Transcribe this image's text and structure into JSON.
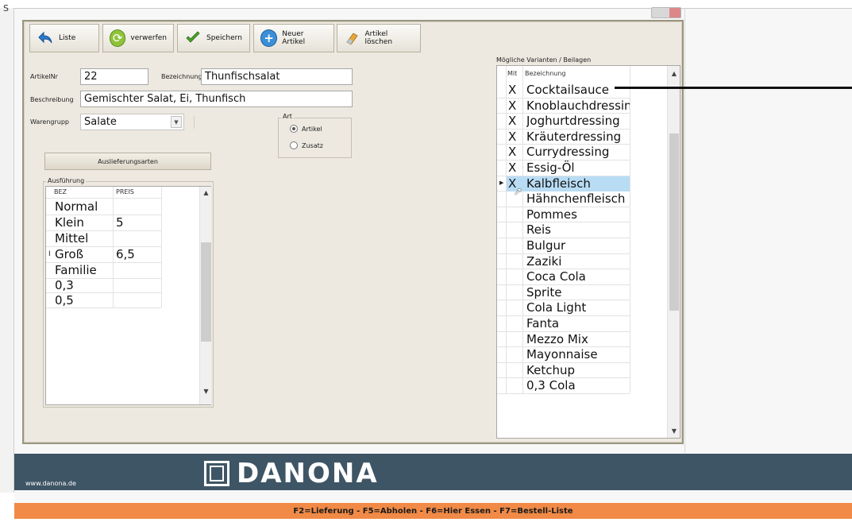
{
  "window": {
    "title_partial": "S"
  },
  "toolbar": {
    "buttons": [
      {
        "label": "Liste",
        "icon": "back-arrow-icon"
      },
      {
        "label": "verwerfen",
        "icon": "refresh-icon"
      },
      {
        "label": "Speichern",
        "icon": "checkmark-icon"
      },
      {
        "label": "Neuer Artikel",
        "icon": "plus-icon"
      },
      {
        "label": "Artikel löschen",
        "icon": "eraser-icon"
      }
    ]
  },
  "form": {
    "artikelnr_label": "ArtikelNr",
    "artikelnr_value": "22",
    "bezeichnung_label": "Bezeichnung",
    "bezeichnung_value": "Thunfischsalat",
    "beschreibung_label": "Beschreibung",
    "beschreibung_value": "Gemischter Salat, Ei, Thunfisch",
    "warengruppe_label": "Warengrupp",
    "warengruppe_value": "Salate",
    "art_title": "Art",
    "art_options": [
      "Artikel",
      "Zusatz"
    ],
    "art_selected": "Artikel",
    "auslieferungsarten_label": "Auslieferungsarten"
  },
  "ausfuehrung": {
    "title": "Ausführung",
    "columns": [
      "BEZ",
      "PREIS"
    ],
    "rows": [
      {
        "bez": "Normal",
        "preis": ""
      },
      {
        "bez": "Klein",
        "preis": "5"
      },
      {
        "bez": "Mittel",
        "preis": ""
      },
      {
        "bez": "Groß",
        "preis": "6,5"
      },
      {
        "bez": "Familie",
        "preis": ""
      },
      {
        "bez": "0,3",
        "preis": ""
      },
      {
        "bez": "0,5",
        "preis": ""
      }
    ]
  },
  "varianten": {
    "title": "Mögliche Varianten / Beilagen",
    "columns": [
      "Mit",
      "Bezeichnung"
    ],
    "rows": [
      {
        "mit": "X",
        "name": "Cocktailsauce"
      },
      {
        "mit": "X",
        "name": "Knoblauchdressin"
      },
      {
        "mit": "X",
        "name": "Joghurtdressing"
      },
      {
        "mit": "X",
        "name": "Kräuterdressing"
      },
      {
        "mit": "X",
        "name": "Currydressing"
      },
      {
        "mit": "X",
        "name": "Essig-Öl"
      },
      {
        "mit": "X",
        "name": "Kalbfleisch"
      },
      {
        "mit": "",
        "name": "Hähnchenfleisch"
      },
      {
        "mit": "",
        "name": "Pommes"
      },
      {
        "mit": "",
        "name": "Reis"
      },
      {
        "mit": "",
        "name": "Bulgur"
      },
      {
        "mit": "",
        "name": "Zaziki"
      },
      {
        "mit": "",
        "name": "Coca Cola"
      },
      {
        "mit": "",
        "name": "Sprite"
      },
      {
        "mit": "",
        "name": "Cola Light"
      },
      {
        "mit": "",
        "name": "Fanta"
      },
      {
        "mit": "",
        "name": "Mezzo Mix"
      },
      {
        "mit": "",
        "name": "Mayonnaise"
      },
      {
        "mit": "",
        "name": "Ketchup"
      },
      {
        "mit": "",
        "name": "0,3 Cola"
      }
    ]
  },
  "footer": {
    "website": "www.danona.de",
    "logo_text": "DANONA",
    "status_text": "F2=Lieferung - F5=Abholen - F6=Hier Essen - F7=Bestell-Liste"
  },
  "colors": {
    "footer_band": "#3e5565",
    "status_bar": "#f08a46",
    "selection": "#b9dcf5"
  }
}
